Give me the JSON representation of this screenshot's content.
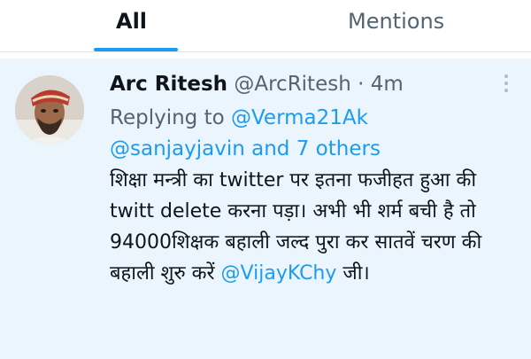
{
  "tabs": {
    "all_label": "All",
    "mentions_label": "Mentions"
  },
  "colors": {
    "accent": "#1d9bf0",
    "highlight_bg": "#eaf5fd",
    "muted_text": "#536471"
  },
  "tweet": {
    "display_name": "Arc Ritesh",
    "handle": "@ArcRitesh",
    "separator": " · ",
    "time": "4m",
    "replying_prefix": "Replying to ",
    "replying_to_1": "@Verma21Ak",
    "replying_to_2": "@sanjayjavin",
    "replying_and": " and ",
    "replying_others": "7 others",
    "body_text": "शिक्षा मन्त्री का twitter पर इतना फजीहत हुआ की twitt delete करना पड़ा। अभी भी शर्म बची है तो 94000शिक्षक बहाली जल्द पुरा कर सातवें चरण की बहाली शुरु करें ",
    "body_mention": "@VijayKChy",
    "body_suffix": " जी।"
  },
  "icons": {
    "more": "more-vertical-icon",
    "avatar": "user-avatar"
  }
}
